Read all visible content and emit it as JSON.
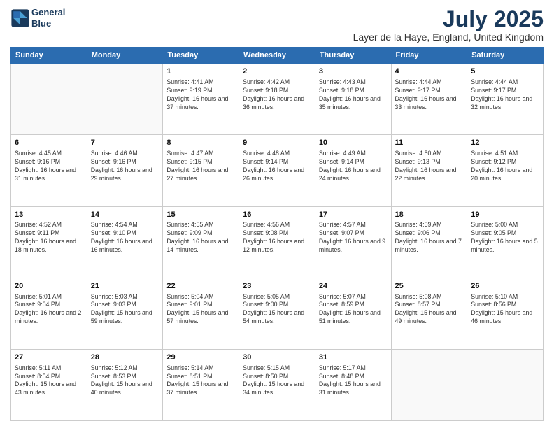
{
  "header": {
    "logo_line1": "General",
    "logo_line2": "Blue",
    "title": "July 2025",
    "subtitle": "Layer de la Haye, England, United Kingdom"
  },
  "calendar": {
    "days_of_week": [
      "Sunday",
      "Monday",
      "Tuesday",
      "Wednesday",
      "Thursday",
      "Friday",
      "Saturday"
    ],
    "weeks": [
      [
        {
          "day": "",
          "info": ""
        },
        {
          "day": "",
          "info": ""
        },
        {
          "day": "1",
          "info": "Sunrise: 4:41 AM\nSunset: 9:19 PM\nDaylight: 16 hours and 37 minutes."
        },
        {
          "day": "2",
          "info": "Sunrise: 4:42 AM\nSunset: 9:18 PM\nDaylight: 16 hours and 36 minutes."
        },
        {
          "day": "3",
          "info": "Sunrise: 4:43 AM\nSunset: 9:18 PM\nDaylight: 16 hours and 35 minutes."
        },
        {
          "day": "4",
          "info": "Sunrise: 4:44 AM\nSunset: 9:17 PM\nDaylight: 16 hours and 33 minutes."
        },
        {
          "day": "5",
          "info": "Sunrise: 4:44 AM\nSunset: 9:17 PM\nDaylight: 16 hours and 32 minutes."
        }
      ],
      [
        {
          "day": "6",
          "info": "Sunrise: 4:45 AM\nSunset: 9:16 PM\nDaylight: 16 hours and 31 minutes."
        },
        {
          "day": "7",
          "info": "Sunrise: 4:46 AM\nSunset: 9:16 PM\nDaylight: 16 hours and 29 minutes."
        },
        {
          "day": "8",
          "info": "Sunrise: 4:47 AM\nSunset: 9:15 PM\nDaylight: 16 hours and 27 minutes."
        },
        {
          "day": "9",
          "info": "Sunrise: 4:48 AM\nSunset: 9:14 PM\nDaylight: 16 hours and 26 minutes."
        },
        {
          "day": "10",
          "info": "Sunrise: 4:49 AM\nSunset: 9:14 PM\nDaylight: 16 hours and 24 minutes."
        },
        {
          "day": "11",
          "info": "Sunrise: 4:50 AM\nSunset: 9:13 PM\nDaylight: 16 hours and 22 minutes."
        },
        {
          "day": "12",
          "info": "Sunrise: 4:51 AM\nSunset: 9:12 PM\nDaylight: 16 hours and 20 minutes."
        }
      ],
      [
        {
          "day": "13",
          "info": "Sunrise: 4:52 AM\nSunset: 9:11 PM\nDaylight: 16 hours and 18 minutes."
        },
        {
          "day": "14",
          "info": "Sunrise: 4:54 AM\nSunset: 9:10 PM\nDaylight: 16 hours and 16 minutes."
        },
        {
          "day": "15",
          "info": "Sunrise: 4:55 AM\nSunset: 9:09 PM\nDaylight: 16 hours and 14 minutes."
        },
        {
          "day": "16",
          "info": "Sunrise: 4:56 AM\nSunset: 9:08 PM\nDaylight: 16 hours and 12 minutes."
        },
        {
          "day": "17",
          "info": "Sunrise: 4:57 AM\nSunset: 9:07 PM\nDaylight: 16 hours and 9 minutes."
        },
        {
          "day": "18",
          "info": "Sunrise: 4:59 AM\nSunset: 9:06 PM\nDaylight: 16 hours and 7 minutes."
        },
        {
          "day": "19",
          "info": "Sunrise: 5:00 AM\nSunset: 9:05 PM\nDaylight: 16 hours and 5 minutes."
        }
      ],
      [
        {
          "day": "20",
          "info": "Sunrise: 5:01 AM\nSunset: 9:04 PM\nDaylight: 16 hours and 2 minutes."
        },
        {
          "day": "21",
          "info": "Sunrise: 5:03 AM\nSunset: 9:03 PM\nDaylight: 15 hours and 59 minutes."
        },
        {
          "day": "22",
          "info": "Sunrise: 5:04 AM\nSunset: 9:01 PM\nDaylight: 15 hours and 57 minutes."
        },
        {
          "day": "23",
          "info": "Sunrise: 5:05 AM\nSunset: 9:00 PM\nDaylight: 15 hours and 54 minutes."
        },
        {
          "day": "24",
          "info": "Sunrise: 5:07 AM\nSunset: 8:59 PM\nDaylight: 15 hours and 51 minutes."
        },
        {
          "day": "25",
          "info": "Sunrise: 5:08 AM\nSunset: 8:57 PM\nDaylight: 15 hours and 49 minutes."
        },
        {
          "day": "26",
          "info": "Sunrise: 5:10 AM\nSunset: 8:56 PM\nDaylight: 15 hours and 46 minutes."
        }
      ],
      [
        {
          "day": "27",
          "info": "Sunrise: 5:11 AM\nSunset: 8:54 PM\nDaylight: 15 hours and 43 minutes."
        },
        {
          "day": "28",
          "info": "Sunrise: 5:12 AM\nSunset: 8:53 PM\nDaylight: 15 hours and 40 minutes."
        },
        {
          "day": "29",
          "info": "Sunrise: 5:14 AM\nSunset: 8:51 PM\nDaylight: 15 hours and 37 minutes."
        },
        {
          "day": "30",
          "info": "Sunrise: 5:15 AM\nSunset: 8:50 PM\nDaylight: 15 hours and 34 minutes."
        },
        {
          "day": "31",
          "info": "Sunrise: 5:17 AM\nSunset: 8:48 PM\nDaylight: 15 hours and 31 minutes."
        },
        {
          "day": "",
          "info": ""
        },
        {
          "day": "",
          "info": ""
        }
      ]
    ]
  }
}
